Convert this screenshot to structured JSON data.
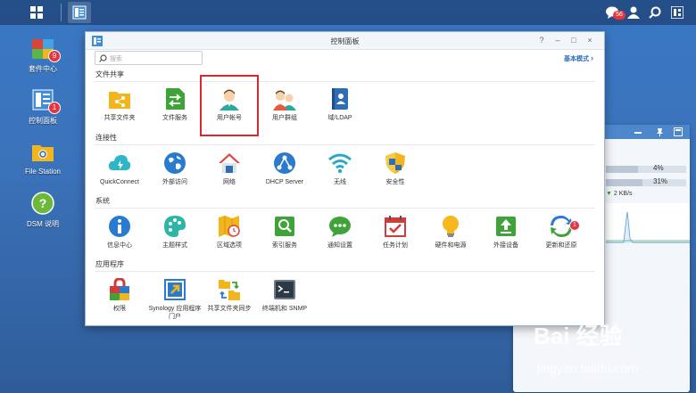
{
  "taskbar": {
    "notification_count": "56"
  },
  "desktop": [
    {
      "label": "套件中心",
      "badge": "9"
    },
    {
      "label": "控制面板",
      "badge": "1"
    },
    {
      "label": "File Station",
      "badge": ""
    },
    {
      "label": "DSM 说明",
      "badge": ""
    }
  ],
  "widget": {
    "cpu": "4%",
    "ram": "31%",
    "download": "2 KB/s"
  },
  "window": {
    "title": "控制面板",
    "search_placeholder": "搜索",
    "basic_mode": "基本模式",
    "sections": [
      {
        "title": "文件共享",
        "items": [
          "共享文件夹",
          "文件服务",
          "用户帐号",
          "用户群组",
          "域/LDAP"
        ]
      },
      {
        "title": "连接性",
        "items": [
          "QuickConnect",
          "外部访问",
          "网络",
          "DHCP Server",
          "无线",
          "安全性"
        ]
      },
      {
        "title": "系统",
        "items": [
          "信息中心",
          "主题样式",
          "区域选项",
          "索引服务",
          "通知设置",
          "任务计划",
          "硬件和电源",
          "外接设备",
          "更新和还原"
        ]
      },
      {
        "title": "应用程序",
        "items": [
          "权限",
          "Synology 应用程序门户",
          "共享文件夹同步",
          "终端机和 SNMP"
        ]
      }
    ],
    "update_badge": "1"
  },
  "watermark": {
    "logo": "Bai 经验",
    "site": "jingyan.baidu.com"
  },
  "colors": {
    "accent": "#2a6ebd",
    "highlight": "#d9272e",
    "badge": "#e3363e"
  }
}
